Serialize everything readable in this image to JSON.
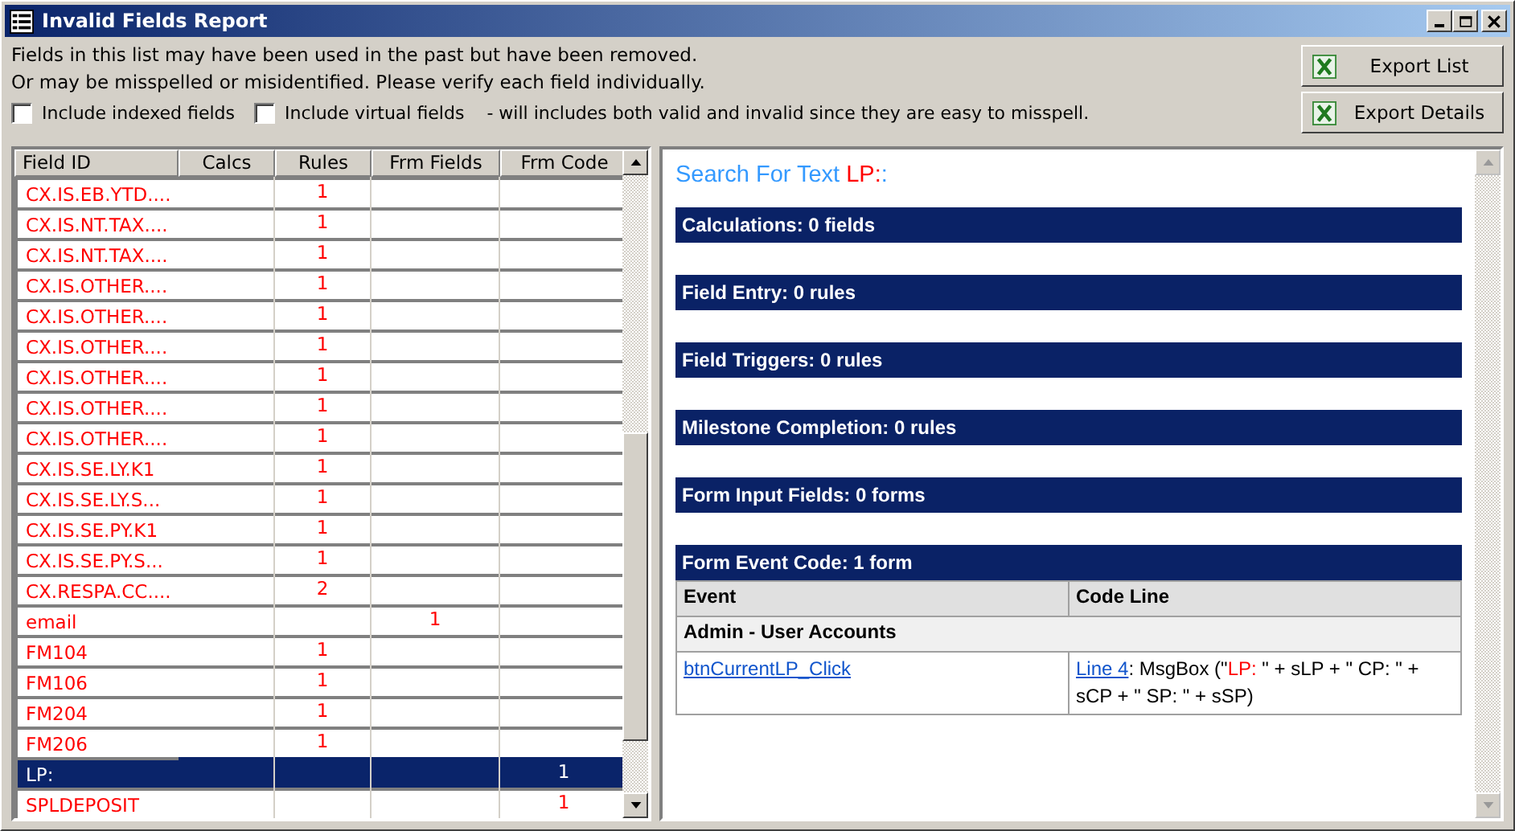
{
  "window": {
    "title": "Invalid Fields Report"
  },
  "intro": [
    "Fields in this list may have been used in the past but have been removed.",
    "Or may be misspelled or misidentified.  Please verify each field individually."
  ],
  "options": [
    {
      "label": "Include indexed fields",
      "checked": false
    },
    {
      "label": "Include virtual fields",
      "checked": false
    }
  ],
  "options_note": "- will includes both valid and invalid since they are easy to misspell.",
  "buttons": [
    "Export List",
    "Export Details"
  ],
  "table": {
    "columns": [
      "Field ID",
      "Calcs",
      "Rules",
      "Frm Fields",
      "Frm Code"
    ],
    "rows": [
      {
        "field_id": "CX.IS.EB.YTD....",
        "rules": "1",
        "selected": false
      },
      {
        "field_id": "CX.IS.NT.TAX....",
        "rules": "1",
        "selected": false
      },
      {
        "field_id": "CX.IS.NT.TAX....",
        "rules": "1",
        "selected": false
      },
      {
        "field_id": "CX.IS.OTHER....",
        "rules": "1",
        "selected": false
      },
      {
        "field_id": "CX.IS.OTHER....",
        "rules": "1",
        "selected": false
      },
      {
        "field_id": "CX.IS.OTHER....",
        "rules": "1",
        "selected": false
      },
      {
        "field_id": "CX.IS.OTHER....",
        "rules": "1",
        "selected": false
      },
      {
        "field_id": "CX.IS.OTHER....",
        "rules": "1",
        "selected": false
      },
      {
        "field_id": "CX.IS.OTHER....",
        "rules": "1",
        "selected": false
      },
      {
        "field_id": "CX.IS.SE.LY.K1",
        "rules": "1",
        "selected": false
      },
      {
        "field_id": "CX.IS.SE.LY.S...",
        "rules": "1",
        "selected": false
      },
      {
        "field_id": "CX.IS.SE.PY.K1",
        "rules": "1",
        "selected": false
      },
      {
        "field_id": "CX.IS.SE.PY.S...",
        "rules": "1",
        "selected": false
      },
      {
        "field_id": "CX.RESPA.CC....",
        "rules": "2",
        "selected": false
      },
      {
        "field_id": "email",
        "frm_fields": "1",
        "selected": false
      },
      {
        "field_id": "FM104",
        "rules": "1",
        "selected": false
      },
      {
        "field_id": "FM106",
        "rules": "1",
        "selected": false
      },
      {
        "field_id": "FM204",
        "rules": "1",
        "selected": false
      },
      {
        "field_id": "FM206",
        "rules": "1",
        "selected": false
      },
      {
        "field_id": "LP:",
        "frm_code": "1",
        "selected": true
      },
      {
        "field_id": "SPLDEPOSIT",
        "frm_code": "1",
        "selected": false
      }
    ]
  },
  "details": {
    "search_label": "Search For Text",
    "search_term": "LP:",
    "search_suffix": ":",
    "sections": [
      {
        "title": "Calculations: 0 fields"
      },
      {
        "title": "Field Entry: 0 rules"
      },
      {
        "title": "Field Triggers: 0 rules"
      },
      {
        "title": "Milestone Completion: 0 rules"
      },
      {
        "title": "Form Input Fields: 0 forms"
      },
      {
        "title": "Form Event Code: 1 form",
        "table": {
          "columns": [
            "Event",
            "Code Line"
          ],
          "groups": [
            {
              "name": "Admin - User Accounts",
              "rows": [
                {
                  "event": "btnCurrentLP_Click",
                  "line_link": "Line 4",
                  "code_before": ": MsgBox (\"",
                  "code_match": "LP:",
                  "code_after": " \" + sLP + \" CP: \" + sCP + \" SP: \" + sSP)"
                }
              ]
            }
          ]
        }
      }
    ]
  }
}
